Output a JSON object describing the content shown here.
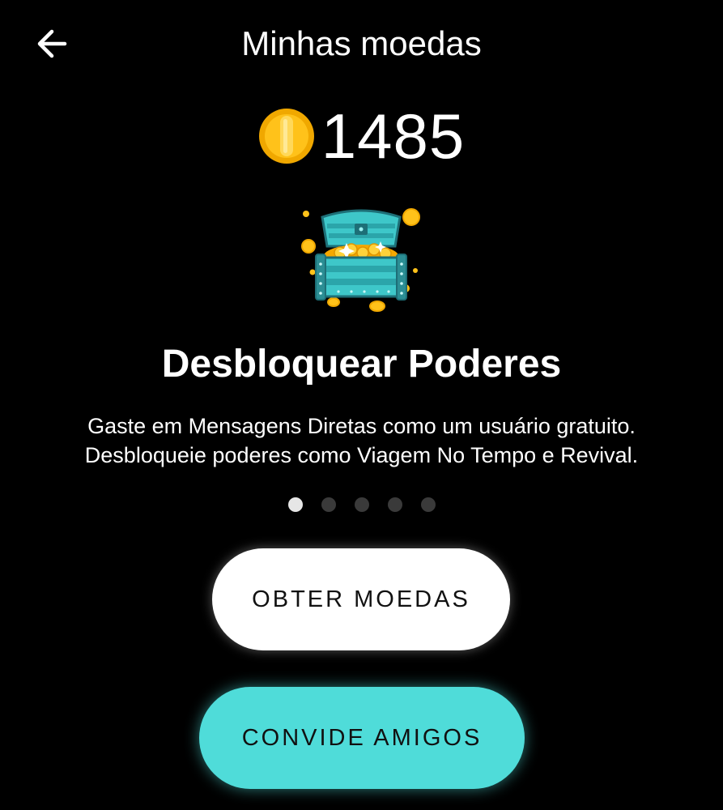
{
  "header": {
    "title": "Minhas moedas",
    "back_icon": "arrow-left-icon"
  },
  "balance": {
    "icon": "coin-icon",
    "value": "1485",
    "coin_color": "#f5b800"
  },
  "feature": {
    "illustration": "treasure-chest-icon",
    "title": "Desbloquear Poderes",
    "description_line1": "Gaste em Mensagens Diretas como um usuário gratuito.",
    "description_line2": "Desbloqueie poderes como Viagem No Tempo e Revival."
  },
  "pager": {
    "count": 5,
    "active_index": 0
  },
  "actions": {
    "primary_label": "OBTER MOEDAS",
    "secondary_label": "CONVIDE AMIGOS",
    "secondary_color": "#4fdcd9"
  }
}
